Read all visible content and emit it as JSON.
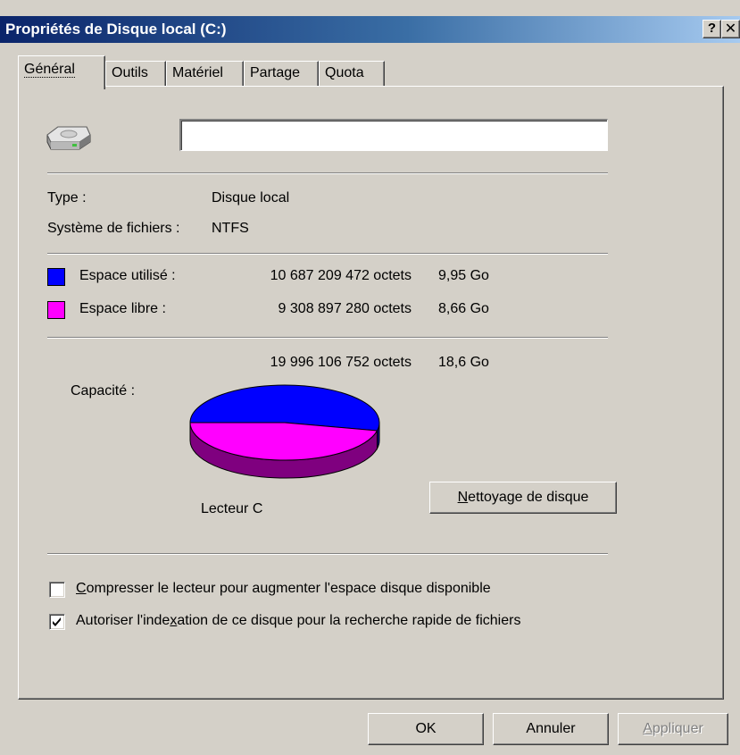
{
  "window": {
    "title": "Propriétés de Disque local (C:)",
    "help_label": "?",
    "close_label": "✕"
  },
  "tabs": [
    {
      "label": "Général",
      "active": true
    },
    {
      "label": "Outils",
      "active": false
    },
    {
      "label": "Matériel",
      "active": false
    },
    {
      "label": "Partage",
      "active": false
    },
    {
      "label": "Quota",
      "active": false
    }
  ],
  "general": {
    "drive_icon": "hard-drive-icon",
    "name_value": "",
    "type_label": "Type :",
    "type_value": "Disque local",
    "fs_label": "Système de fichiers :",
    "fs_value": "NTFS",
    "used_label": "Espace utilisé :",
    "used_bytes": "10 687 209 472 octets",
    "used_size": "9,95 Go",
    "free_label": "Espace libre :",
    "free_bytes": "9 308 897 280 octets",
    "free_size": "8,66 Go",
    "capacity_label": "Capacité :",
    "capacity_bytes": "19 996 106 752 octets",
    "capacity_size": "18,6 Go",
    "drive_label": "Lecteur C",
    "cleanup_button": {
      "accel": "N",
      "rest": "ettoyage de disque"
    },
    "compress": {
      "pre": "",
      "accel": "C",
      "post": "ompresser le lecteur pour augmenter l'espace disque disponible",
      "checked": false
    },
    "index": {
      "pre": "Autoriser l'inde",
      "accel": "x",
      "post": "ation de ce disque pour la recherche rapide de fichiers",
      "checked": true
    }
  },
  "colors": {
    "used": "#0000ff",
    "used_dark": "#00007f",
    "free": "#ff00ff",
    "free_dark": "#7f007f"
  },
  "chart_data": {
    "type": "pie",
    "slices": [
      {
        "name": "Espace utilisé",
        "value": 10687209472
      },
      {
        "name": "Espace libre",
        "value": 9308897280
      }
    ]
  },
  "footer": {
    "ok": "OK",
    "cancel": "Annuler",
    "apply": {
      "accel": "A",
      "rest": "ppliquer"
    }
  }
}
